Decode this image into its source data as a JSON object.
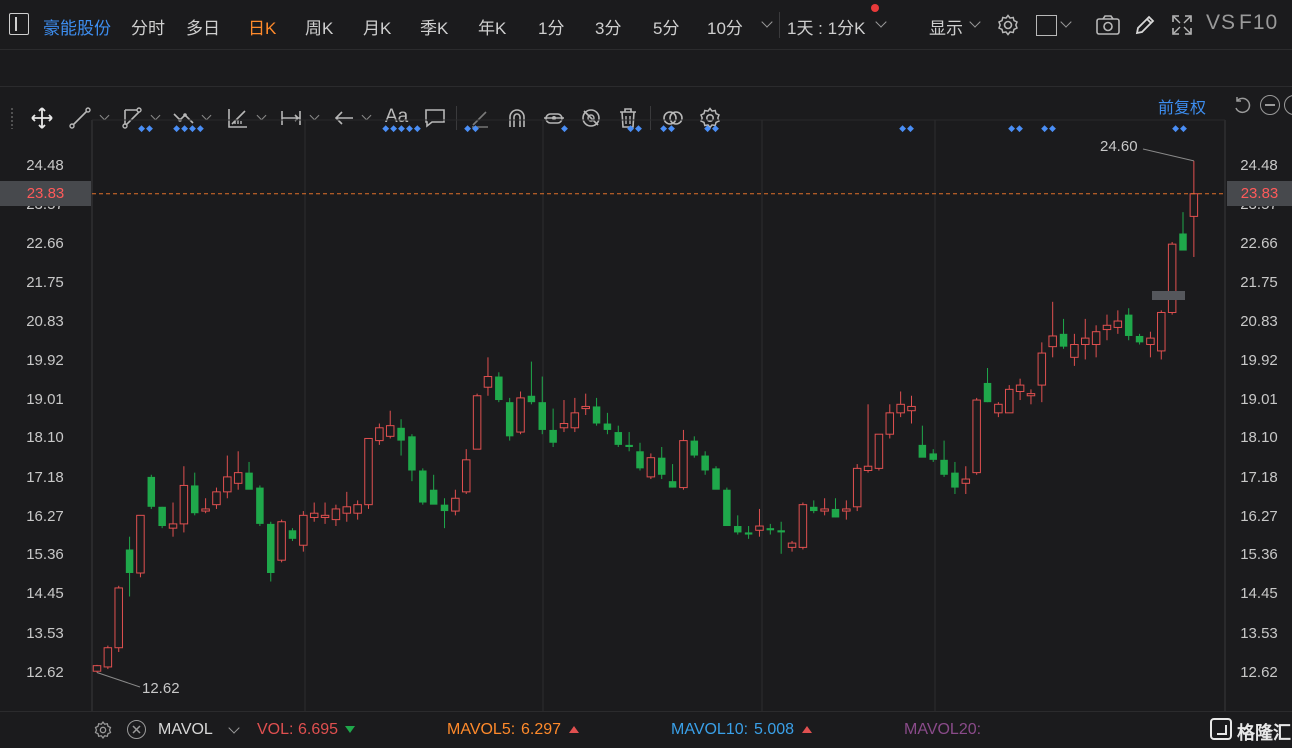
{
  "toolbar": {
    "stock_name": "豪能股份",
    "periods": [
      "分时",
      "多日",
      "日K",
      "周K",
      "月K",
      "季K",
      "年K",
      "1分",
      "3分",
      "5分",
      "10分"
    ],
    "active_period": "日K",
    "interval_select": "1天 : 1分K",
    "display_label": "显示",
    "vs_label": "VS",
    "f10_label": "F10"
  },
  "drawing_tools": [
    "move-icon",
    "line-icon",
    "polyline-icon",
    "wave-icon",
    "measure-icon",
    "range-icon",
    "arrow-icon",
    "text-icon",
    "comment-icon",
    "brush-icon",
    "magnet-icon",
    "lock-icon",
    "hide-icon",
    "trash-icon",
    "eye-icon",
    "settings-icon"
  ],
  "chart_header": {
    "adjust_label": "前复权"
  },
  "colors": {
    "up": "#e05050",
    "down": "#1fa84b",
    "marker": "#4a8ef5",
    "accent_active": "#ff8a2b",
    "price_line": "#e0702a"
  },
  "chart_data": {
    "type": "candlestick",
    "ylim": [
      12.3,
      25.1
    ],
    "y_ticks": [
      "24.48",
      "23.57",
      "22.66",
      "21.75",
      "20.83",
      "19.92",
      "19.01",
      "18.10",
      "17.18",
      "16.27",
      "15.36",
      "14.45",
      "13.53",
      "12.62"
    ],
    "current_price": "23.83",
    "high_label": "24.60",
    "low_label": "12.62",
    "candles": [
      {
        "o": 12.65,
        "h": 12.8,
        "l": 12.62,
        "c": 12.78
      },
      {
        "o": 12.75,
        "h": 13.25,
        "l": 12.7,
        "c": 13.2
      },
      {
        "o": 13.2,
        "h": 14.65,
        "l": 13.1,
        "c": 14.6
      },
      {
        "o": 15.5,
        "h": 15.8,
        "l": 14.4,
        "c": 14.95
      },
      {
        "o": 14.95,
        "h": 16.3,
        "l": 14.85,
        "c": 16.3
      },
      {
        "o": 17.2,
        "h": 17.25,
        "l": 16.45,
        "c": 16.5
      },
      {
        "o": 16.5,
        "h": 16.5,
        "l": 16.0,
        "c": 16.05
      },
      {
        "o": 16.0,
        "h": 16.6,
        "l": 15.8,
        "c": 16.1
      },
      {
        "o": 16.1,
        "h": 17.45,
        "l": 15.9,
        "c": 17.0
      },
      {
        "o": 17.0,
        "h": 17.3,
        "l": 16.3,
        "c": 16.35
      },
      {
        "o": 16.4,
        "h": 16.7,
        "l": 16.35,
        "c": 16.45
      },
      {
        "o": 16.55,
        "h": 16.95,
        "l": 16.45,
        "c": 16.85
      },
      {
        "o": 16.85,
        "h": 17.7,
        "l": 16.7,
        "c": 17.2
      },
      {
        "o": 17.05,
        "h": 17.8,
        "l": 16.9,
        "c": 17.3
      },
      {
        "o": 17.3,
        "h": 17.55,
        "l": 16.95,
        "c": 16.9
      },
      {
        "o": 16.95,
        "h": 17.0,
        "l": 16.05,
        "c": 16.1
      },
      {
        "o": 16.1,
        "h": 16.15,
        "l": 14.75,
        "c": 14.95
      },
      {
        "o": 15.25,
        "h": 16.2,
        "l": 15.2,
        "c": 16.15
      },
      {
        "o": 15.95,
        "h": 16.0,
        "l": 15.7,
        "c": 15.75
      },
      {
        "o": 15.6,
        "h": 16.4,
        "l": 15.45,
        "c": 16.3
      },
      {
        "o": 16.25,
        "h": 16.6,
        "l": 16.15,
        "c": 16.35
      },
      {
        "o": 16.25,
        "h": 16.6,
        "l": 16.1,
        "c": 16.3
      },
      {
        "o": 16.2,
        "h": 16.55,
        "l": 16.05,
        "c": 16.45
      },
      {
        "o": 16.35,
        "h": 16.85,
        "l": 16.15,
        "c": 16.5
      },
      {
        "o": 16.35,
        "h": 16.65,
        "l": 16.2,
        "c": 16.55
      },
      {
        "o": 16.55,
        "h": 17.55,
        "l": 16.45,
        "c": 18.1
      },
      {
        "o": 18.05,
        "h": 18.45,
        "l": 17.95,
        "c": 18.35
      },
      {
        "o": 18.15,
        "h": 18.75,
        "l": 18.1,
        "c": 18.4
      },
      {
        "o": 18.35,
        "h": 18.55,
        "l": 17.7,
        "c": 18.05
      },
      {
        "o": 18.15,
        "h": 18.2,
        "l": 17.1,
        "c": 17.35
      },
      {
        "o": 17.35,
        "h": 17.4,
        "l": 16.55,
        "c": 16.6
      },
      {
        "o": 16.9,
        "h": 17.25,
        "l": 16.85,
        "c": 16.55
      },
      {
        "o": 16.55,
        "h": 16.7,
        "l": 16.0,
        "c": 16.4
      },
      {
        "o": 16.4,
        "h": 16.9,
        "l": 16.3,
        "c": 16.7
      },
      {
        "o": 16.85,
        "h": 17.85,
        "l": 16.8,
        "c": 17.6
      },
      {
        "o": 17.85,
        "h": 19.15,
        "l": 17.85,
        "c": 19.1
      },
      {
        "o": 19.3,
        "h": 20.0,
        "l": 19.1,
        "c": 19.55
      },
      {
        "o": 19.55,
        "h": 19.65,
        "l": 18.95,
        "c": 19.0
      },
      {
        "o": 18.95,
        "h": 19.05,
        "l": 18.05,
        "c": 18.15
      },
      {
        "o": 18.25,
        "h": 19.2,
        "l": 18.2,
        "c": 19.05
      },
      {
        "o": 19.1,
        "h": 19.9,
        "l": 18.9,
        "c": 18.95
      },
      {
        "o": 18.95,
        "h": 19.55,
        "l": 18.2,
        "c": 18.3
      },
      {
        "o": 18.3,
        "h": 18.8,
        "l": 17.9,
        "c": 18.0
      },
      {
        "o": 18.35,
        "h": 19.0,
        "l": 18.25,
        "c": 18.45
      },
      {
        "o": 18.35,
        "h": 19.05,
        "l": 18.25,
        "c": 18.7
      },
      {
        "o": 18.8,
        "h": 19.15,
        "l": 18.65,
        "c": 18.85
      },
      {
        "o": 18.85,
        "h": 19.05,
        "l": 18.4,
        "c": 18.45
      },
      {
        "o": 18.45,
        "h": 18.7,
        "l": 18.2,
        "c": 18.3
      },
      {
        "o": 18.25,
        "h": 18.4,
        "l": 17.9,
        "c": 17.95
      },
      {
        "o": 17.95,
        "h": 18.25,
        "l": 17.8,
        "c": 17.9
      },
      {
        "o": 17.8,
        "h": 18.0,
        "l": 17.35,
        "c": 17.4
      },
      {
        "o": 17.2,
        "h": 17.75,
        "l": 17.15,
        "c": 17.65
      },
      {
        "o": 17.65,
        "h": 17.9,
        "l": 17.15,
        "c": 17.25
      },
      {
        "o": 17.1,
        "h": 17.5,
        "l": 16.95,
        "c": 16.95
      },
      {
        "o": 16.95,
        "h": 18.3,
        "l": 16.9,
        "c": 18.05
      },
      {
        "o": 18.05,
        "h": 18.15,
        "l": 17.65,
        "c": 17.7
      },
      {
        "o": 17.7,
        "h": 17.8,
        "l": 17.25,
        "c": 17.35
      },
      {
        "o": 17.4,
        "h": 17.45,
        "l": 16.95,
        "c": 16.9
      },
      {
        "o": 16.9,
        "h": 16.95,
        "l": 16.05,
        "c": 16.05
      },
      {
        "o": 16.05,
        "h": 16.3,
        "l": 15.85,
        "c": 15.9
      },
      {
        "o": 15.9,
        "h": 16.05,
        "l": 15.75,
        "c": 15.85
      },
      {
        "o": 15.95,
        "h": 16.45,
        "l": 15.8,
        "c": 16.05
      },
      {
        "o": 16.0,
        "h": 16.1,
        "l": 15.85,
        "c": 15.95
      },
      {
        "o": 15.95,
        "h": 16.15,
        "l": 15.4,
        "c": 15.9
      },
      {
        "o": 15.55,
        "h": 15.7,
        "l": 15.45,
        "c": 15.65
      },
      {
        "o": 15.55,
        "h": 16.6,
        "l": 15.5,
        "c": 16.55
      },
      {
        "o": 16.5,
        "h": 16.65,
        "l": 16.35,
        "c": 16.4
      },
      {
        "o": 16.4,
        "h": 16.7,
        "l": 16.3,
        "c": 16.45
      },
      {
        "o": 16.45,
        "h": 16.7,
        "l": 16.25,
        "c": 16.25
      },
      {
        "o": 16.4,
        "h": 16.65,
        "l": 16.2,
        "c": 16.45
      },
      {
        "o": 16.5,
        "h": 17.5,
        "l": 16.4,
        "c": 17.4
      },
      {
        "o": 17.35,
        "h": 18.9,
        "l": 17.3,
        "c": 17.45
      },
      {
        "o": 17.4,
        "h": 18.15,
        "l": 17.35,
        "c": 18.2
      },
      {
        "o": 18.2,
        "h": 18.9,
        "l": 18.1,
        "c": 18.7
      },
      {
        "o": 18.7,
        "h": 19.2,
        "l": 18.6,
        "c": 18.9
      },
      {
        "o": 18.75,
        "h": 19.1,
        "l": 18.45,
        "c": 18.85
      },
      {
        "o": 17.95,
        "h": 18.4,
        "l": 17.9,
        "c": 17.65
      },
      {
        "o": 17.75,
        "h": 17.85,
        "l": 17.55,
        "c": 17.6
      },
      {
        "o": 17.6,
        "h": 18.05,
        "l": 17.2,
        "c": 17.25
      },
      {
        "o": 17.3,
        "h": 17.55,
        "l": 16.8,
        "c": 16.95
      },
      {
        "o": 17.05,
        "h": 17.45,
        "l": 16.8,
        "c": 17.15
      },
      {
        "o": 17.3,
        "h": 19.05,
        "l": 17.25,
        "c": 19.0
      },
      {
        "o": 19.4,
        "h": 19.75,
        "l": 18.95,
        "c": 18.95
      },
      {
        "o": 18.7,
        "h": 18.95,
        "l": 18.6,
        "c": 18.9
      },
      {
        "o": 18.7,
        "h": 19.35,
        "l": 18.7,
        "c": 19.25
      },
      {
        "o": 19.2,
        "h": 19.5,
        "l": 19.0,
        "c": 19.35
      },
      {
        "o": 19.1,
        "h": 19.25,
        "l": 18.9,
        "c": 19.15
      },
      {
        "o": 19.35,
        "h": 20.35,
        "l": 18.95,
        "c": 20.1
      },
      {
        "o": 20.25,
        "h": 21.3,
        "l": 20.0,
        "c": 20.5
      },
      {
        "o": 20.55,
        "h": 20.9,
        "l": 20.2,
        "c": 20.25
      },
      {
        "o": 20.0,
        "h": 20.55,
        "l": 19.8,
        "c": 20.3
      },
      {
        "o": 20.3,
        "h": 20.9,
        "l": 19.95,
        "c": 20.45
      },
      {
        "o": 20.3,
        "h": 20.75,
        "l": 20.0,
        "c": 20.6
      },
      {
        "o": 20.65,
        "h": 21.0,
        "l": 20.4,
        "c": 20.75
      },
      {
        "o": 20.7,
        "h": 21.1,
        "l": 20.55,
        "c": 20.85
      },
      {
        "o": 21.0,
        "h": 21.15,
        "l": 20.4,
        "c": 20.5
      },
      {
        "o": 20.5,
        "h": 20.55,
        "l": 20.3,
        "c": 20.35
      },
      {
        "o": 20.3,
        "h": 20.6,
        "l": 20.0,
        "c": 20.45
      },
      {
        "o": 20.15,
        "h": 21.1,
        "l": 19.95,
        "c": 21.05
      },
      {
        "o": 21.05,
        "h": 22.7,
        "l": 21.0,
        "c": 22.65
      },
      {
        "o": 22.9,
        "h": 23.4,
        "l": 22.5,
        "c": 22.5
      },
      {
        "o": 23.3,
        "h": 24.6,
        "l": 22.35,
        "c": 23.83
      }
    ],
    "event_markers": [
      "◆◆",
      "◆◆◆◆",
      "◆◆◆◆◆",
      "◆◆",
      "◆",
      "◆◆",
      "◆◆",
      "◆◆",
      "◆◆",
      "◆◆",
      "◆◆",
      "◆◆"
    ]
  },
  "bottom": {
    "indicator_name": "MAVOL",
    "vol_label": "VOL:",
    "vol_value": "6.695",
    "mavol5_label": "MAVOL5:",
    "mavol5_value": "6.297",
    "mavol10_label": "MAVOL10:",
    "mavol10_value": "5.008",
    "mavol20_label": "MAVOL20:",
    "watermark": "格隆汇"
  }
}
